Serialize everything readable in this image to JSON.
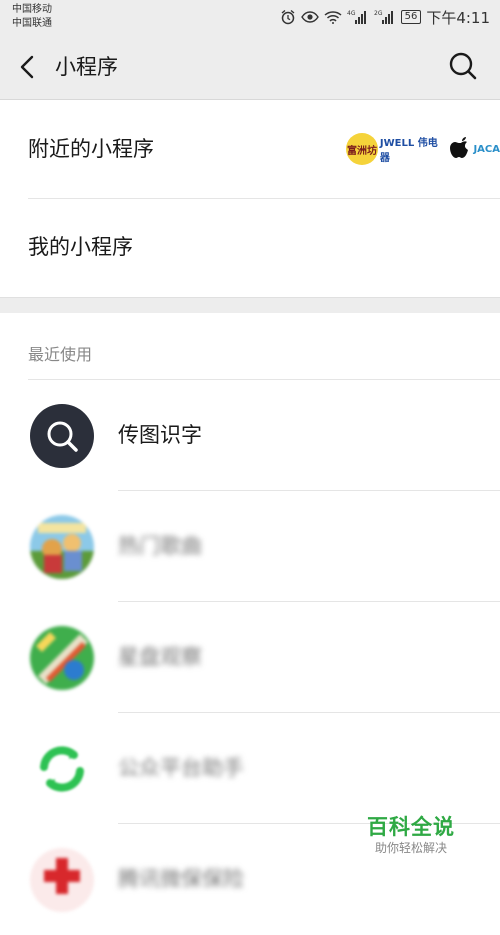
{
  "status_bar": {
    "carrier_1": "中国移动",
    "carrier_2": "中国联通",
    "battery": "56",
    "time": "下午4:11",
    "icons": [
      "alarm-icon",
      "eye-icon",
      "wifi-icon",
      "signal-4g-icon",
      "signal-2g-icon",
      "battery-icon"
    ]
  },
  "nav": {
    "title": "小程序",
    "back_icon": "chevron-left-icon",
    "search_icon": "search-icon"
  },
  "menu": {
    "nearby_label": "附近的小程序",
    "mine_label": "我的小程序",
    "nearby_thumbnail_texts": [
      "富洲坊",
      "JWELL 伟电器",
      "JACA"
    ]
  },
  "recent": {
    "header": "最近使用",
    "items": [
      {
        "name": "传图识字",
        "icon": "search-icon",
        "blurred": false
      },
      {
        "name": "热门歌曲",
        "icon": "app-avatar",
        "blurred": true
      },
      {
        "name": "星盘观察",
        "icon": "app-avatar",
        "blurred": true
      },
      {
        "name": "公众平台助手",
        "icon": "refresh-icon",
        "blurred": true
      },
      {
        "name": "腾讯微保保险",
        "icon": "app-avatar",
        "blurred": true
      }
    ]
  },
  "watermark": {
    "main": "百科全说",
    "sub": "助你轻松解决"
  },
  "colors": {
    "background_gray": "#ededed",
    "dark_circle": "#2b2f3a",
    "watermark_green": "#2fa944"
  }
}
